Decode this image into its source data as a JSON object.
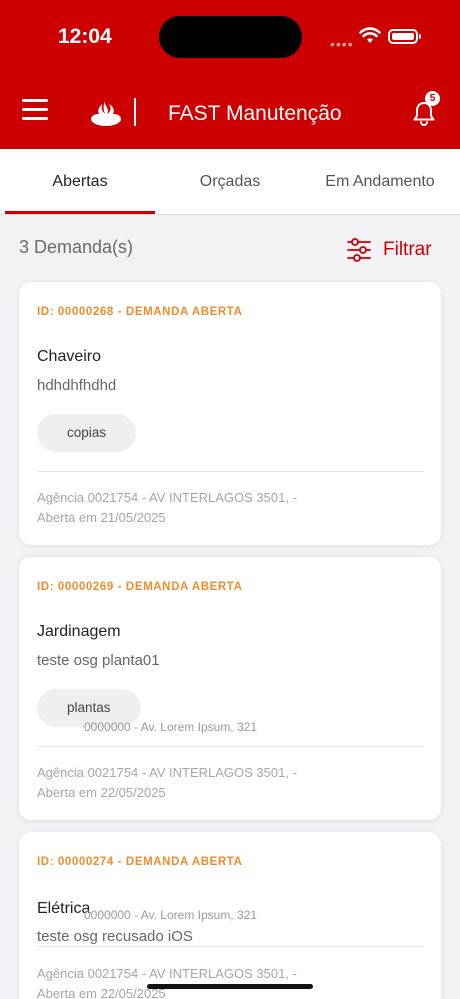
{
  "status_bar": {
    "time": "12:04"
  },
  "header": {
    "app_title": "FAST Manutenção",
    "notification_count": "5",
    "brand_color": "#cc0000"
  },
  "tabs": [
    {
      "label": "Abertas",
      "active": true
    },
    {
      "label": "Orçadas",
      "active": false
    },
    {
      "label": "Em Andamento",
      "active": false
    }
  ],
  "list": {
    "count_label": "3 Demanda(s)",
    "filter_label": "Filtrar"
  },
  "cards": [
    {
      "id_label": "ID: 00000268 - DEMANDA ABERTA",
      "title": "Chaveiro",
      "description": "hdhdhfhdhd",
      "chip": "copias",
      "address": "Agência 0021754 - AV INTERLAGOS 3501, -",
      "opened": "Aberta em 21/05/2025"
    },
    {
      "id_label": "ID: 00000269 - DEMANDA ABERTA",
      "title": "Jardinagem",
      "description": "teste osg planta01",
      "chip": "plantas",
      "address": "Agência 0021754 - AV INTERLAGOS 3501, -",
      "opened": "Aberta em 22/05/2025"
    },
    {
      "id_label": "ID: 00000274 - DEMANDA ABERTA",
      "title": "Elétrica",
      "description": "teste osg recusado iOS",
      "address": "Agência 0021754 - AV INTERLAGOS 3501, -",
      "opened": "Aberta em 22/05/2025"
    }
  ],
  "ghost_texts": [
    "0000000 - Av. Lorem Ipsum, 321",
    "0000000 - Av. Lorem Ipsum, 321"
  ],
  "icons": [
    "wifi-icon",
    "battery-icon",
    "menu-icon",
    "santander-flame-icon",
    "bell-icon",
    "filter-sliders-icon"
  ]
}
